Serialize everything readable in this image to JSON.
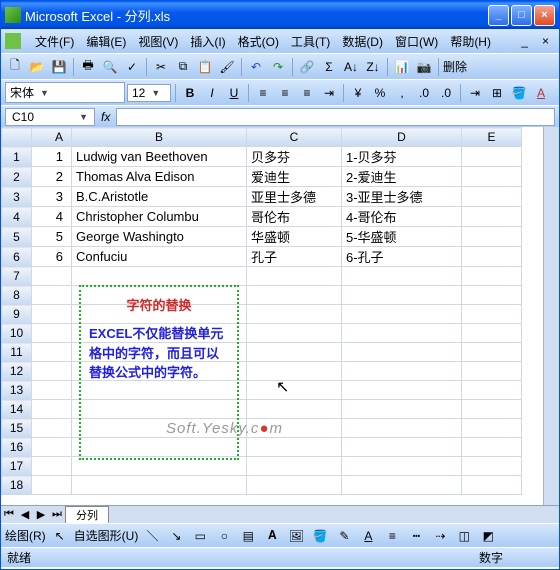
{
  "window": {
    "title": "Microsoft Excel - 分列.xls"
  },
  "menu": {
    "items": [
      "文件(F)",
      "编辑(E)",
      "视图(V)",
      "插入(I)",
      "格式(O)",
      "工具(T)",
      "数据(D)",
      "窗口(W)",
      "帮助(H)"
    ],
    "askQuestion": ""
  },
  "format": {
    "fontName": "宋体",
    "fontSize": "12",
    "bold": "B",
    "italic": "I",
    "underline": "U"
  },
  "namebox": {
    "ref": "C10",
    "fx": "fx"
  },
  "columns": [
    "A",
    "B",
    "C",
    "D",
    "E"
  ],
  "rows": [
    {
      "n": "1",
      "a": "1",
      "b": "Ludwig van Beethoven",
      "c": "贝多芬",
      "d": "1-贝多芬"
    },
    {
      "n": "2",
      "a": "2",
      "b": "Thomas Alva Edison",
      "c": "爱迪生",
      "d": "2-爱迪生"
    },
    {
      "n": "3",
      "a": "3",
      "b": "B.C.Aristotle",
      "c": "亚里士多德",
      "d": "3-亚里士多德"
    },
    {
      "n": "4",
      "a": "4",
      "b": "Christopher Columbu",
      "c": "哥伦布",
      "d": "4-哥伦布"
    },
    {
      "n": "5",
      "a": "5",
      "b": "George Washingto",
      "c": "华盛顿",
      "d": "5-华盛顿"
    },
    {
      "n": "6",
      "a": "6",
      "b": "Confuciu",
      "c": "孔子",
      "d": "6-孔子"
    },
    {
      "n": "7"
    },
    {
      "n": "8"
    },
    {
      "n": "9"
    },
    {
      "n": "10"
    },
    {
      "n": "11"
    },
    {
      "n": "12"
    },
    {
      "n": "13"
    },
    {
      "n": "14"
    },
    {
      "n": "15"
    },
    {
      "n": "16"
    },
    {
      "n": "17"
    },
    {
      "n": "18"
    }
  ],
  "textbox": {
    "title": "字符的替换",
    "body": "EXCEL不仅能替换单元格中的字符，而且可以替换公式中的字符。"
  },
  "watermark": {
    "pre": "Soft.Yesky.c",
    "dot": "●",
    "post": "m"
  },
  "sheetTab": "分列",
  "drawbar": {
    "label": "绘图(R)",
    "autoshape": "自选图形(U)"
  },
  "status": {
    "ready": "就绪",
    "num": "数字"
  },
  "toolbar": {
    "delete": "删除"
  }
}
